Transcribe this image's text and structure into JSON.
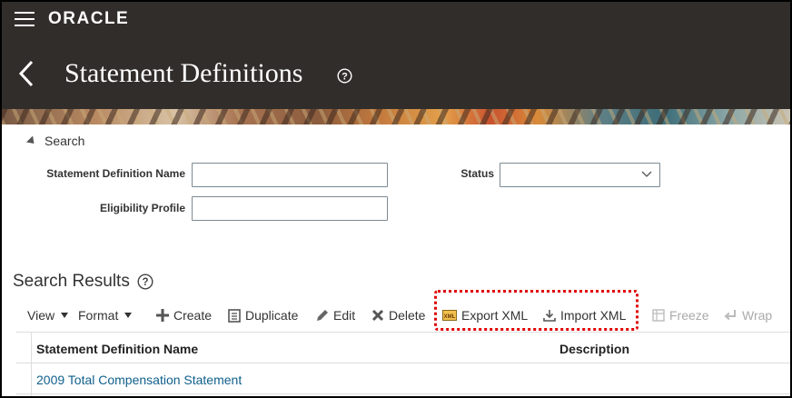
{
  "header": {
    "brand": "ORACLE",
    "page_title": "Statement Definitions"
  },
  "search": {
    "toggle_label": "Search",
    "fields": {
      "statement_definition_name": {
        "label": "Statement Definition Name",
        "value": ""
      },
      "eligibility_profile": {
        "label": "Eligibility Profile",
        "value": ""
      },
      "status": {
        "label": "Status",
        "value": ""
      }
    }
  },
  "results": {
    "title": "Search Results",
    "toolbar": {
      "view": "View",
      "format": "Format",
      "create": "Create",
      "duplicate": "Duplicate",
      "edit": "Edit",
      "delete": "Delete",
      "export_xml": "Export XML",
      "import_xml": "Import XML",
      "freeze": "Freeze",
      "wrap": "Wrap"
    },
    "columns": [
      "Statement Definition Name",
      "Description"
    ],
    "rows": [
      {
        "name": "2009 Total Compensation Statement",
        "description": ""
      }
    ]
  },
  "colors": {
    "header_bg": "#312d2a",
    "link": "#0f5f8c",
    "highlight": "#e00000"
  }
}
